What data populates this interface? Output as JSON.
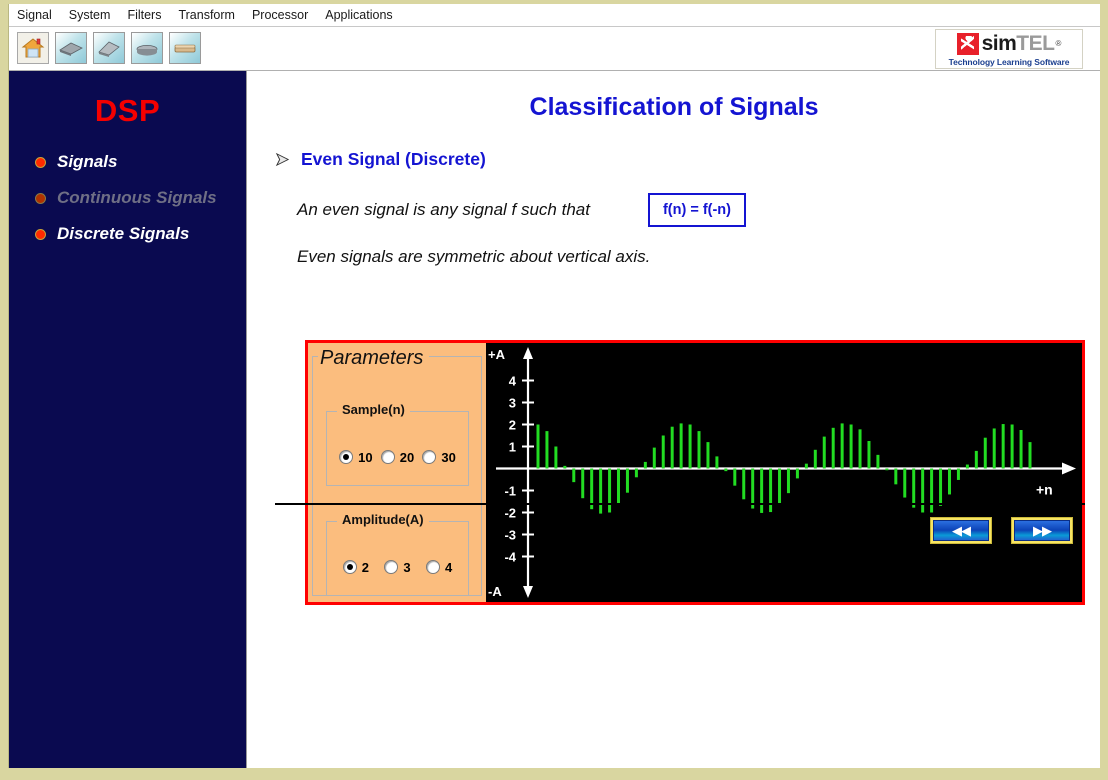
{
  "menu": {
    "items": [
      "Signal",
      "System",
      "Filters",
      "Transform",
      "Processor",
      "Applications"
    ]
  },
  "toolbar": {
    "buttons": [
      {
        "name": "home-icon",
        "label": "Home"
      },
      {
        "name": "book-prev-icon",
        "label": "Previous Book"
      },
      {
        "name": "book-open-icon",
        "label": "Open Book"
      },
      {
        "name": "book-closed-icon",
        "label": "Closed Book"
      },
      {
        "name": "book-next-icon",
        "label": "Next Book"
      }
    ]
  },
  "logo": {
    "sim": "sim",
    "tel": "TEL",
    "registered": "®",
    "tagline": "Technology Learning Software"
  },
  "sidebar": {
    "title": "DSP",
    "items": [
      {
        "label": "Signals",
        "dim": false
      },
      {
        "label": "Continuous Signals",
        "dim": true
      },
      {
        "label": "Discrete Signals",
        "dim": false
      }
    ]
  },
  "main": {
    "page_title": "Classification of Signals",
    "section_title": "Even Signal (Discrete)",
    "paragraph_1": "An even signal is any signal f such that",
    "formula": "f(n) = f(-n)",
    "paragraph_2": "Even signals are symmetric about vertical axis."
  },
  "parameters": {
    "legend": "Parameters",
    "sample": {
      "legend": "Sample(n)",
      "options": [
        "10",
        "20",
        "30"
      ],
      "selected": "10"
    },
    "amplitude": {
      "legend": "Amplitude(A)",
      "options": [
        "2",
        "3",
        "4"
      ],
      "selected": "2"
    }
  },
  "footer": {
    "prev_label": "◀◀",
    "next_label": "▶▶"
  },
  "colors": {
    "accent_red": "#f50000",
    "title_blue": "#1414d2",
    "sidebar_bg": "#0a0a50",
    "panel_orange": "#fbbd7e",
    "plot_bg": "#000000",
    "stem_green": "#22dd22",
    "frame_red": "#ff0000",
    "window_frame": "#d9d6a0"
  },
  "chart_data": {
    "type": "bar",
    "title": "",
    "xlabel": "+n",
    "ylabel": "",
    "y_top_label": "+A",
    "y_bottom_label": "-A",
    "yticks": [
      4,
      3,
      2,
      1,
      -1,
      -2,
      -3,
      -4
    ],
    "ylim": [
      -4.8,
      4.8
    ],
    "grid": false,
    "legend": false,
    "description": "Discrete even signal stem plot, amplitude 2, sampled sinusoid symmetric about vertical axis",
    "x": [
      0,
      1,
      2,
      3,
      4,
      5,
      6,
      7,
      8,
      9,
      10,
      11,
      12,
      13,
      14,
      15,
      16,
      17,
      18,
      19,
      20,
      21,
      22,
      23,
      24,
      25,
      26,
      27,
      28,
      29,
      30,
      31,
      32,
      33,
      34,
      35,
      36,
      37,
      38,
      39,
      40,
      41,
      42,
      43,
      44,
      45,
      46,
      47,
      48,
      49,
      50,
      51,
      52,
      53,
      54,
      55
    ],
    "values": [
      2.0,
      1.7,
      1.0,
      0.12,
      -0.62,
      -1.35,
      -1.85,
      -2.05,
      -2.0,
      -1.62,
      -1.1,
      -0.4,
      0.3,
      0.95,
      1.5,
      1.9,
      2.05,
      2.0,
      1.7,
      1.2,
      0.55,
      -0.12,
      -0.78,
      -1.4,
      -1.82,
      -2.02,
      -1.98,
      -1.65,
      -1.12,
      -0.45,
      0.22,
      0.85,
      1.45,
      1.85,
      2.05,
      2.0,
      1.78,
      1.25,
      0.62,
      -0.08,
      -0.72,
      -1.32,
      -1.78,
      -2.0,
      -2.0,
      -1.7,
      -1.18,
      -0.52,
      0.18,
      0.8,
      1.4,
      1.82,
      2.02,
      2.0,
      1.75,
      1.2
    ]
  }
}
